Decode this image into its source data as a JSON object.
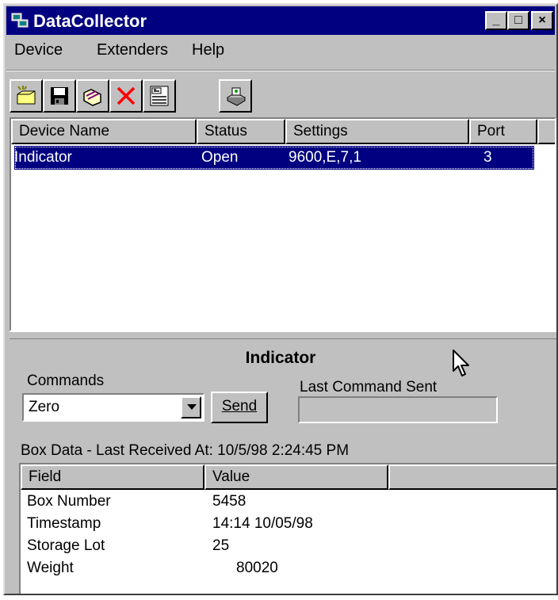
{
  "window": {
    "title": "DataCollector"
  },
  "title_buttons": {
    "minimize": "_",
    "maximize": "□",
    "close": "×"
  },
  "menu": {
    "items": [
      "Device",
      "Extenders",
      "Help"
    ]
  },
  "toolbar": {
    "buttons": [
      "new-device-icon",
      "save-icon",
      "open-icon",
      "delete-icon",
      "properties-icon",
      "print-icon"
    ]
  },
  "device_list": {
    "columns": [
      "Device Name",
      "Status",
      "Settings",
      "Port"
    ],
    "rows": [
      {
        "name": "Indicator",
        "status": "Open",
        "settings": "9600,E,7,1",
        "port": "3"
      }
    ]
  },
  "device_panel": {
    "title": "Indicator",
    "commands_label": "Commands",
    "command_value": "Zero",
    "send_label": "Send",
    "last_command_label": "Last Command Sent",
    "last_command_value": ""
  },
  "box_data": {
    "caption": "Box Data - Last Received At: 10/5/98 2:24:45 PM",
    "columns": [
      "Field",
      "Value"
    ],
    "rows": [
      {
        "field": "Box Number",
        "value": "5458"
      },
      {
        "field": "Timestamp",
        "value": "14:14 10/05/98"
      },
      {
        "field": "Storage Lot",
        "value": "25"
      },
      {
        "field": "Weight",
        "value": "80020"
      }
    ]
  },
  "colors": {
    "selection": "#000080",
    "titlebar": "#000080",
    "face": "#c0c0c0"
  }
}
